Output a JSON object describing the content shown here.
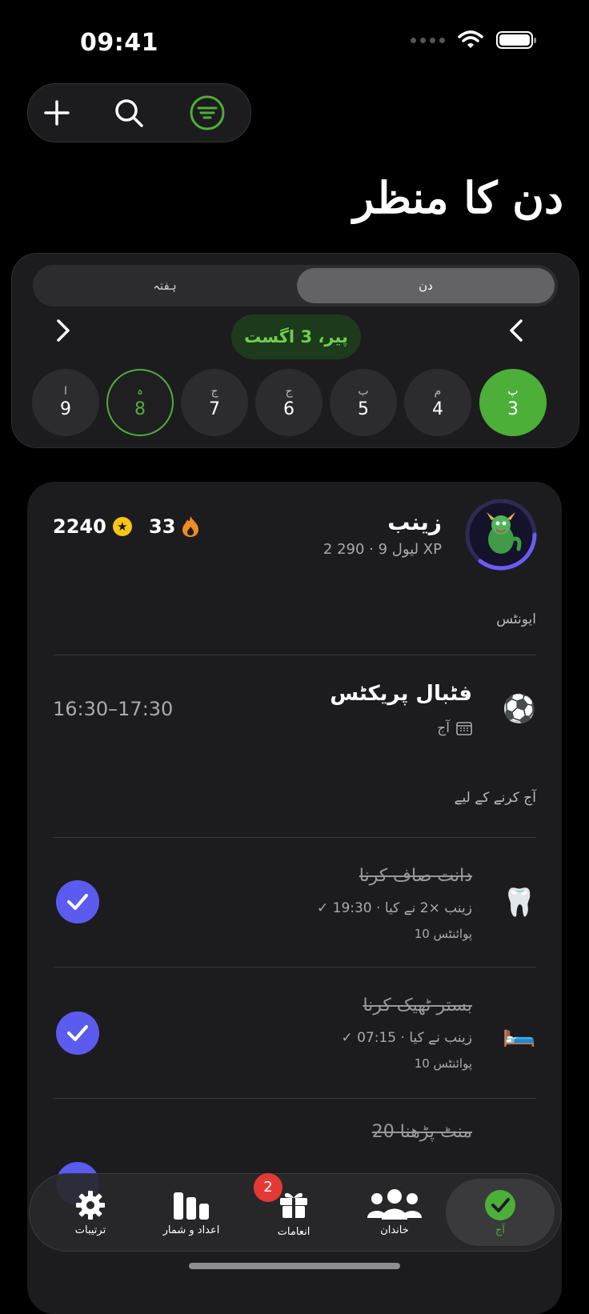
{
  "status_bar": {
    "time": "09:41"
  },
  "toolbar": {
    "add_icon": "plus-icon",
    "search_icon": "search-icon",
    "filter_icon": "filter-icon",
    "accent": "#4caf38"
  },
  "page_title": "دن کا منظر",
  "calendar": {
    "segments": {
      "day": "دن",
      "week": "ہفتہ"
    },
    "date_label": "پیر، 3 اگست",
    "days": [
      {
        "letter": "پ",
        "num": "3",
        "state": "selected"
      },
      {
        "letter": "م",
        "num": "4",
        "state": "normal"
      },
      {
        "letter": "ب",
        "num": "5",
        "state": "normal"
      },
      {
        "letter": "ج",
        "num": "6",
        "state": "normal"
      },
      {
        "letter": "ج",
        "num": "7",
        "state": "normal"
      },
      {
        "letter": "ہ",
        "num": "8",
        "state": "outlined"
      },
      {
        "letter": "ا",
        "num": "9",
        "state": "normal"
      }
    ]
  },
  "profile": {
    "name": "زینب",
    "level_line": "لیول 9 · 290 2 XP",
    "coins": "2240",
    "streak": "33",
    "avatar_icon": "dragon-avatar-icon",
    "level_progress": 0.35
  },
  "events_section": {
    "label": "ایونٹس",
    "event": {
      "emoji": "⚽",
      "title": "فٹبال پریکٹس",
      "calendar_text": "آج",
      "time": "16:30–17:30"
    }
  },
  "todo_section": {
    "label": "آج کرنے کے لیے",
    "tasks": [
      {
        "emoji": "🦷",
        "title": "دانت صاف کرنا",
        "meta": "✓ زینب ×2 نے کیا · 19:30",
        "points": "10 پوائنٹس",
        "done": true
      },
      {
        "emoji": "🛏️",
        "title": "بستر ٹھیک کرنا",
        "meta": "✓ زینب نے کیا · 07:15",
        "points": "10 پوائنٹس",
        "done": true
      },
      {
        "emoji": "",
        "title": "20 منٹ پڑھنا",
        "meta": "",
        "points": "",
        "done": true
      }
    ]
  },
  "tabbar": {
    "tabs": [
      {
        "label": "ترتیبات",
        "icon": "gear-icon"
      },
      {
        "label": "اعداد و شمار",
        "icon": "bar-chart-icon"
      },
      {
        "label": "انعامات",
        "icon": "gift-icon",
        "badge": "2"
      },
      {
        "label": "خاندان",
        "icon": "family-icon"
      },
      {
        "label": "آج",
        "icon": "check-circle-icon",
        "active": true
      }
    ]
  }
}
